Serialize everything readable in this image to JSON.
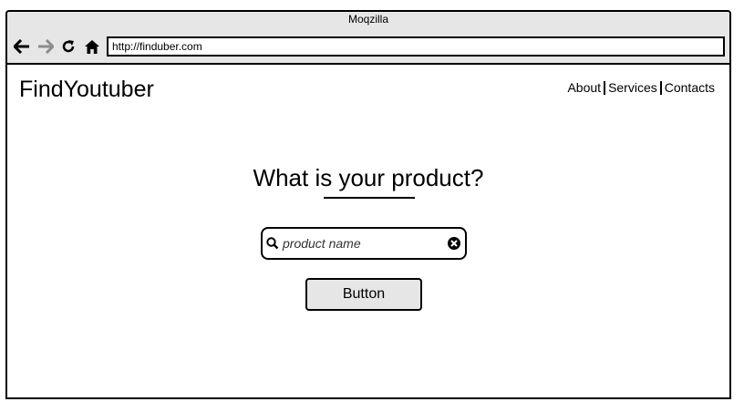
{
  "browser": {
    "title": "Moqzilla",
    "address": "http://finduber.com",
    "icons": [
      "back-arrow-icon",
      "forward-arrow-icon",
      "reload-icon",
      "home-icon"
    ]
  },
  "site": {
    "logo": "FindYoutuber",
    "nav": [
      "About",
      "Services",
      "Contacts"
    ]
  },
  "main": {
    "heading": "What is your product?",
    "search_placeholder": "product name",
    "button_label": "Button"
  }
}
